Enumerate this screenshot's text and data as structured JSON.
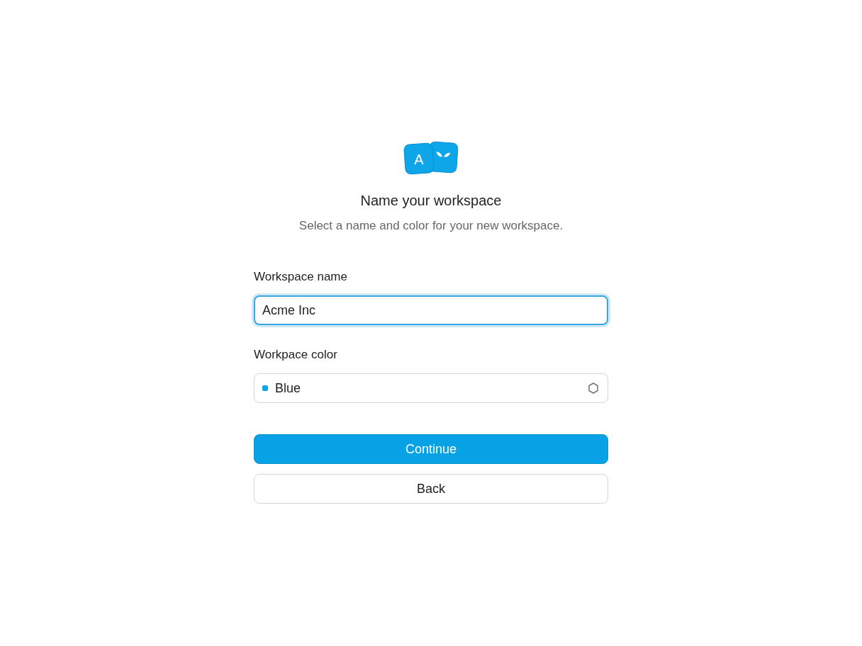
{
  "logo": {
    "letter": "A"
  },
  "title": "Name your workspace",
  "subtitle": "Select a name and color for your new workspace.",
  "name_field": {
    "label": "Workspace name",
    "value": "Acme Inc",
    "focused": true
  },
  "color_field": {
    "label": "Workpace color",
    "value": "Blue",
    "color": "#0ea5e9"
  },
  "buttons": [
    {
      "label": "Continue",
      "kind": "primary"
    },
    {
      "label": "Back",
      "kind": "secondary"
    }
  ]
}
